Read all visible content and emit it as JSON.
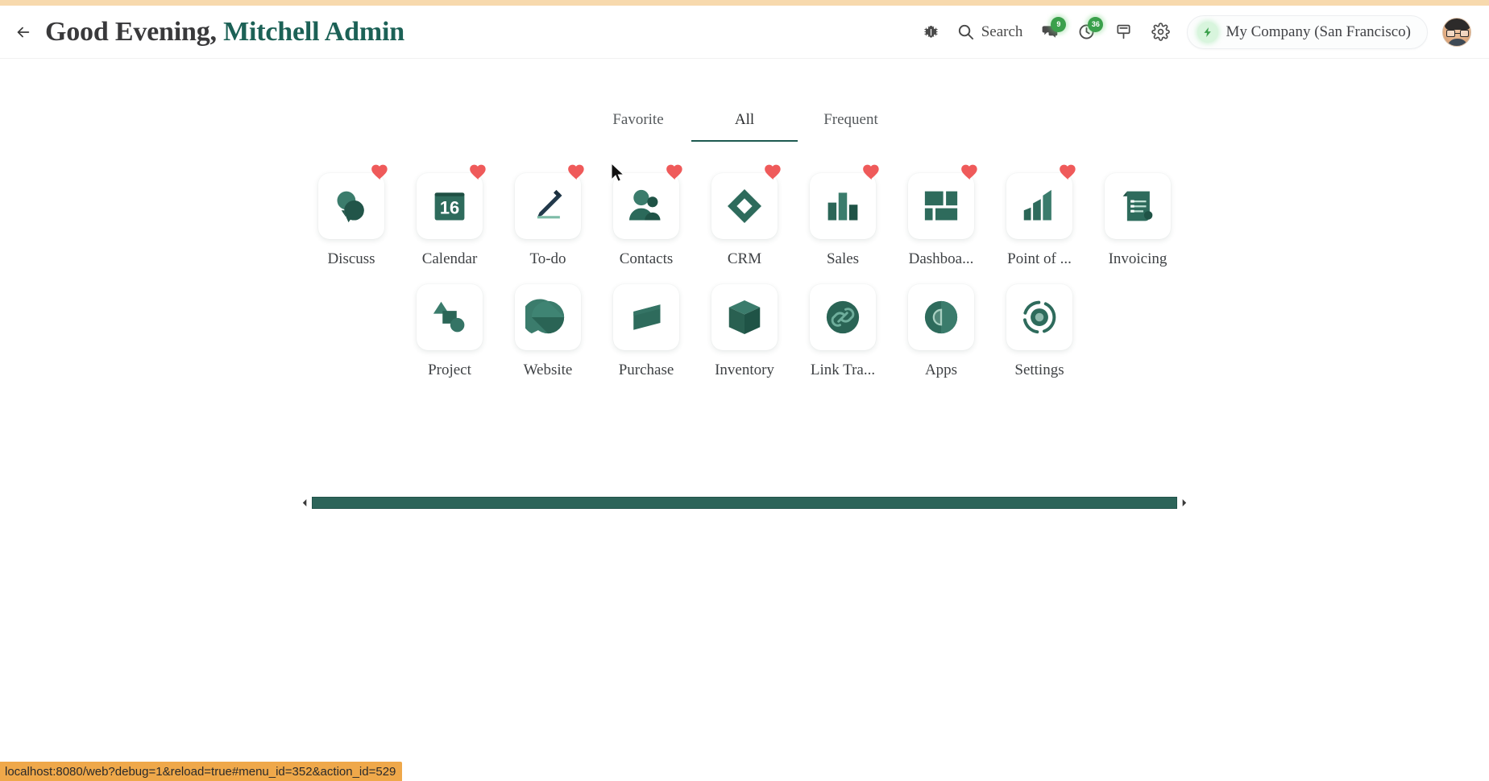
{
  "header": {
    "back_icon": "arrow-left-icon",
    "greeting_prefix": "Good Evening,",
    "user_name": "Mitchell Admin",
    "tray": {
      "bug_icon": "bug-icon",
      "search_icon": "search-icon",
      "search_label": "Search",
      "messages_icon": "chat-bubbles-icon",
      "messages_badge": "9",
      "activities_icon": "clock-icon",
      "activities_badge": "36",
      "presentation_icon": "presentation-board-icon",
      "settings_icon": "gear-icon"
    },
    "company": {
      "bolt_icon": "lightning-bolt-icon",
      "name": "My Company (San Francisco)"
    },
    "avatar_name": "user-avatar"
  },
  "tabs": [
    {
      "label": "Favorite",
      "active": false
    },
    {
      "label": "All",
      "active": true
    },
    {
      "label": "Frequent",
      "active": false
    }
  ],
  "apps": {
    "row1": [
      {
        "label": "Discuss",
        "icon": "discuss-icon",
        "favorite": true
      },
      {
        "label": "Calendar",
        "icon": "calendar-icon",
        "favorite": true,
        "day": "16"
      },
      {
        "label": "To-do",
        "icon": "todo-pencil-icon",
        "favorite": true
      },
      {
        "label": "Contacts",
        "icon": "contacts-icon",
        "favorite": true
      },
      {
        "label": "CRM",
        "icon": "crm-diamond-icon",
        "favorite": true
      },
      {
        "label": "Sales",
        "icon": "sales-bars-icon",
        "favorite": true
      },
      {
        "label": "Dashboa...",
        "icon": "dashboard-icon",
        "favorite": true
      },
      {
        "label": "Point of ...",
        "icon": "pos-bars-icon",
        "favorite": true
      },
      {
        "label": "Invoicing",
        "icon": "invoicing-icon",
        "favorite": false
      }
    ],
    "row2": [
      {
        "label": "Project",
        "icon": "project-shapes-icon",
        "favorite": false
      },
      {
        "label": "Website",
        "icon": "website-globe-icon",
        "favorite": false
      },
      {
        "label": "Purchase",
        "icon": "purchase-icon",
        "favorite": false
      },
      {
        "label": "Inventory",
        "icon": "inventory-cube-icon",
        "favorite": false
      },
      {
        "label": "Link Tra...",
        "icon": "link-tracker-icon",
        "favorite": false
      },
      {
        "label": "Apps",
        "icon": "apps-icon",
        "favorite": false
      },
      {
        "label": "Settings",
        "icon": "settings-rings-icon",
        "favorite": false
      }
    ]
  },
  "scrollbar": {
    "left_arrow_icon": "chevron-left-icon",
    "right_arrow_icon": "chevron-right-icon"
  },
  "statusbar": {
    "url": "localhost:8080/web?debug=1&reload=true#menu_id=352&action_id=529"
  },
  "colors": {
    "brand_green": "#2c6459",
    "icon_green": "#337365",
    "icon_green_dark": "#255a4e",
    "heart_red": "#ef5a5a",
    "badge_green": "#3aa04b",
    "accent_orange": "#f7d9ad",
    "status_orange": "#efa84a",
    "tab_underline": "#1d5a50"
  }
}
